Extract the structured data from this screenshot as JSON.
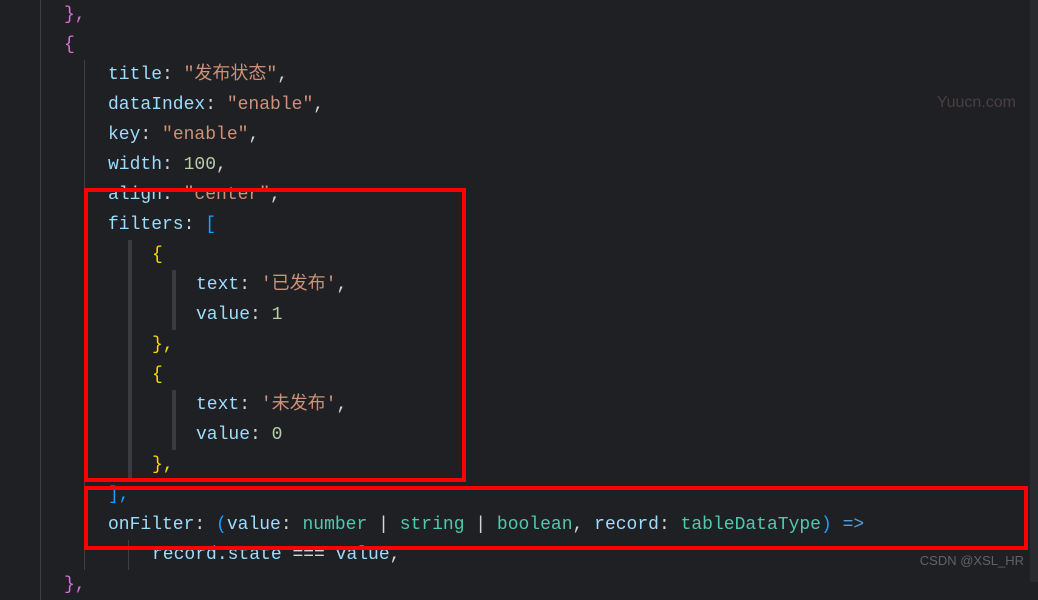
{
  "code": {
    "l0": "},",
    "l1": "{",
    "l2_prop": "title",
    "l2_val": "\"发布状态\"",
    "l3_prop": "dataIndex",
    "l3_val": "\"enable\"",
    "l4_prop": "key",
    "l4_val": "\"enable\"",
    "l5_prop": "width",
    "l5_val": "100",
    "l6_prop": "align",
    "l6_val": "\"center\"",
    "l7_prop": "filters",
    "l7_open": "[",
    "l8": "{",
    "l9_prop": "text",
    "l9_val": "'已发布'",
    "l10_prop": "value",
    "l10_val": "1",
    "l11": "},",
    "l12": "{",
    "l13_prop": "text",
    "l13_val": "'未发布'",
    "l14_prop": "value",
    "l14_val": "0",
    "l15": "},",
    "l16": "],",
    "l17_prop": "onFilter",
    "l17_param1": "value",
    "l17_type1a": "number",
    "l17_type1b": "string",
    "l17_type1c": "boolean",
    "l17_param2": "record",
    "l17_type2": "tableDataType",
    "l17_arrow": "=>",
    "l18_a": "record",
    "l18_b": ".state",
    "l18_c": "===",
    "l18_d": "value",
    "l19": "},"
  },
  "watermark1": "Yuucn.com",
  "watermark2": "CSDN @XSL_HR"
}
